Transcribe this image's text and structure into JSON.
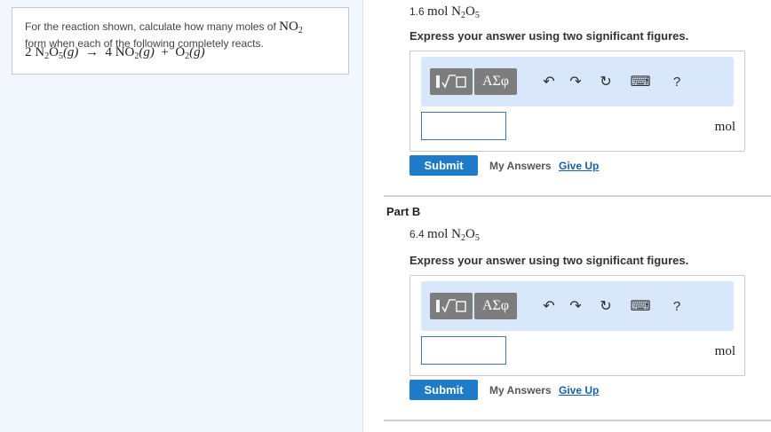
{
  "problem": {
    "line1_prefix": "For the reaction shown, calculate how many moles of",
    "line1_chem_base": "NO",
    "line1_chem_sub": "2",
    "line2": "form when each of the following completely reacts.",
    "equation": {
      "reactant_coef": "2",
      "reactant_base": "N",
      "reactant_sub1": "2",
      "reactant_mid": "O",
      "reactant_sub2": "5",
      "reactant_state": "(g)",
      "arrow": "→",
      "product1_coef": "4",
      "product1_base": "NO",
      "product1_sub": "2",
      "product1_state": "(g)",
      "plus": "+",
      "product2_base": "O",
      "product2_sub": "2",
      "product2_state": "(g)"
    }
  },
  "partA": {
    "amount_num": "1.6",
    "amount_unit": "mol",
    "species_base": "N",
    "species_sub1": "2",
    "species_mid": "O",
    "species_sub2": "5",
    "instruction": "Express your answer using two significant figures.",
    "toolbar": {
      "templates_icon": "templates-icon",
      "greek_label": "ΑΣφ",
      "undo_glyph": "↶",
      "redo_glyph": "↷",
      "reset_glyph": "↻",
      "keyboard_glyph": "⌨",
      "help_label": "?"
    },
    "answer_value": "",
    "unit": "mol",
    "submit_label": "Submit",
    "my_answers_label": "My Answers",
    "give_up_label": "Give Up"
  },
  "partB": {
    "title": "Part B",
    "amount_num": "6.4",
    "amount_unit": "mol",
    "species_base": "N",
    "species_sub1": "2",
    "species_mid": "O",
    "species_sub2": "5",
    "instruction": "Express your answer using two significant figures.",
    "toolbar": {
      "templates_icon": "templates-icon",
      "greek_label": "ΑΣφ",
      "undo_glyph": "↶",
      "redo_glyph": "↷",
      "reset_glyph": "↻",
      "keyboard_glyph": "⌨",
      "help_label": "?"
    },
    "answer_value": "",
    "unit": "mol",
    "submit_label": "Submit",
    "my_answers_label": "My Answers",
    "give_up_label": "Give Up"
  },
  "colors": {
    "accent_blue": "#1f7ac8",
    "link_blue": "#1a5fa8",
    "toolbar_bg": "#d8e8fa",
    "left_pane_bg": "#f2f7fd"
  }
}
